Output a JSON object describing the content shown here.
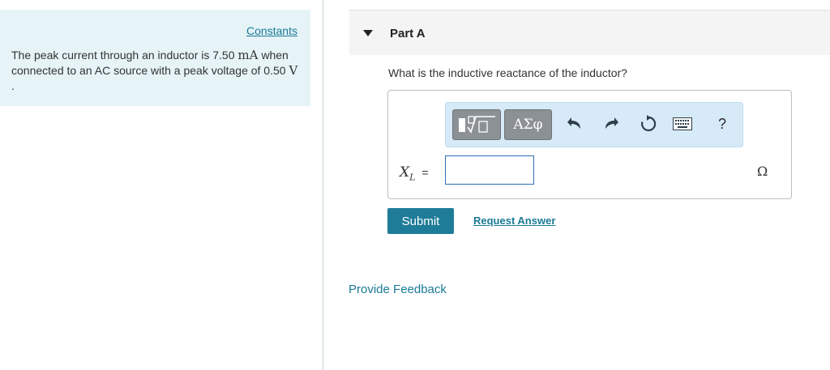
{
  "left_panel": {
    "constants_label": "Constants",
    "problem": {
      "text1": "The peak current through an inductor is 7.50 ",
      "unit1": "mA",
      "text2": " when connected to an AC source with a peak voltage of 0.50 ",
      "unit2": "V",
      "text3": " ."
    }
  },
  "part": {
    "title": "Part A",
    "question": "What is the inductive reactance of the inductor?"
  },
  "toolbar": {
    "symbols_label": "ΑΣφ",
    "help_label": "?",
    "icons": [
      "templates-icon",
      "undo-icon",
      "redo-icon",
      "reset-icon",
      "keyboard-icon",
      "help-icon"
    ]
  },
  "answer": {
    "variable": "X",
    "subscript": "L",
    "equals": "=",
    "value": "",
    "placeholder": "",
    "unit": "Ω"
  },
  "actions": {
    "submit_label": "Submit",
    "request_answer_label": "Request Answer",
    "feedback_label": "Provide Feedback"
  },
  "colors": {
    "info_bg": "#e6f4f8",
    "link": "#1a7a96",
    "submit_bg": "#1f7c98",
    "toolbar_bg": "#d6eaf8",
    "input_border": "#2d6db5"
  }
}
